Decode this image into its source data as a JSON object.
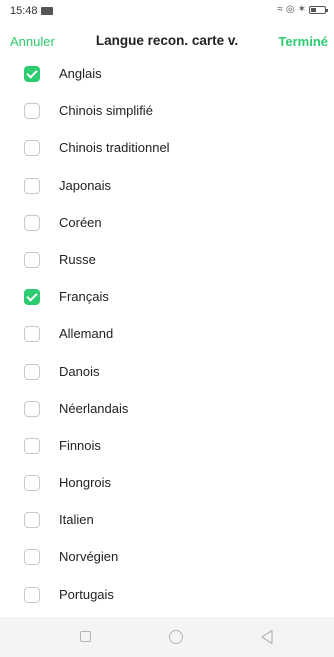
{
  "status_bar": {
    "time": "15:48",
    "icons": [
      "message-icon",
      "vibrate-icon",
      "data-icon",
      "bluetooth-icon",
      "battery-icon"
    ]
  },
  "header": {
    "cancel_label": "Annuler",
    "title": "Langue recon. carte v.",
    "done_label": "Terminé",
    "accent_color": "#2ecc71"
  },
  "languages": [
    {
      "label": "Anglais",
      "checked": true
    },
    {
      "label": "Chinois simplifié",
      "checked": false
    },
    {
      "label": "Chinois traditionnel",
      "checked": false
    },
    {
      "label": "Japonais",
      "checked": false
    },
    {
      "label": "Coréen",
      "checked": false
    },
    {
      "label": "Russe",
      "checked": false
    },
    {
      "label": "Français",
      "checked": true
    },
    {
      "label": "Allemand",
      "checked": false
    },
    {
      "label": "Danois",
      "checked": false
    },
    {
      "label": "Néerlandais",
      "checked": false
    },
    {
      "label": "Finnois",
      "checked": false
    },
    {
      "label": "Hongrois",
      "checked": false
    },
    {
      "label": "Italien",
      "checked": false
    },
    {
      "label": "Norvégien",
      "checked": false
    },
    {
      "label": "Portugais",
      "checked": false
    }
  ],
  "nav_bar": {
    "buttons": [
      "recents-icon",
      "home-icon",
      "back-icon"
    ]
  }
}
